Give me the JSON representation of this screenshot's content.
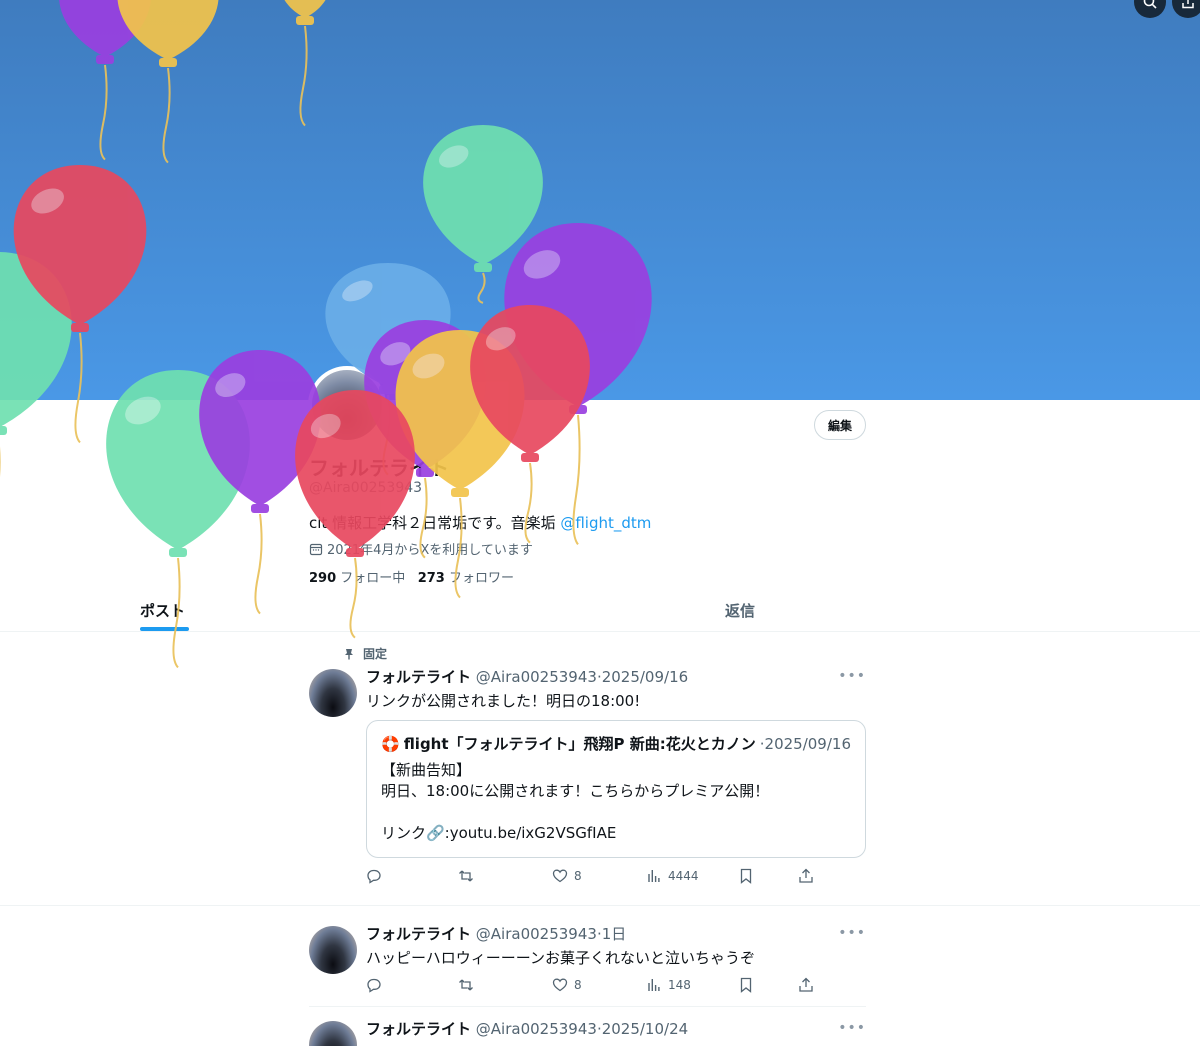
{
  "profile": {
    "name": "フォルテライト",
    "handle": "@Aira00253943",
    "bio_text": "cit 情報工学科２日常垢です。音楽垢 ",
    "bio_mention": "@flight_dtm",
    "joined": "2021年4月からXを利用しています",
    "following_count": "290",
    "following_label": "フォロー中",
    "followers_count": "273",
    "followers_label": "フォロワー",
    "edit_label": "編集"
  },
  "tabs": [
    {
      "label": "ポスト",
      "active": true
    },
    {
      "label": "返信",
      "active": false
    }
  ],
  "pinned_label": "固定",
  "posts": [
    {
      "name": "フォルテライト",
      "handle": "@Aira00253943",
      "date": "·2025/09/16",
      "text": "リンクが公開されました！明日の18:00!",
      "quote": {
        "emoji": "🛟",
        "name": "flight「フォルテライト」飛翔P 新曲:花火とカノン",
        "date": "·2025/09/16",
        "lines": [
          "【新曲告知】",
          "明日、18:00に公開されます！こちらからプレミア公開！",
          "",
          "リンク🔗:youtu.be/ixG2VSGfIAE"
        ]
      },
      "likes": "8",
      "views": "4444"
    },
    {
      "name": "フォルテライト",
      "handle": "@Aira00253943",
      "date": "·1日",
      "text": "ハッピーハロウィーーーンお菓子くれないと泣いちゃうぞ",
      "likes": "8",
      "views": "148"
    },
    {
      "name": "フォルテライト",
      "handle": "@Aira00253943",
      "date": "·2025/10/24"
    }
  ],
  "colors": {
    "accent": "#1d9bf0",
    "banner_top": "#3f7cbf",
    "banner_bottom": "#4a98e6",
    "balloon_red": "#e8485f",
    "balloon_purple": "#9a3fe0",
    "balloon_green": "#6fe0b0",
    "balloon_yellow": "#f3c44a",
    "balloon_blue": "#6aaee8"
  },
  "icons": {
    "top_right": [
      "search-icon",
      "share-icon"
    ],
    "post_actions": [
      "reply-icon",
      "repost-icon",
      "like-icon",
      "views-icon",
      "bookmark-icon",
      "share-icon"
    ]
  }
}
